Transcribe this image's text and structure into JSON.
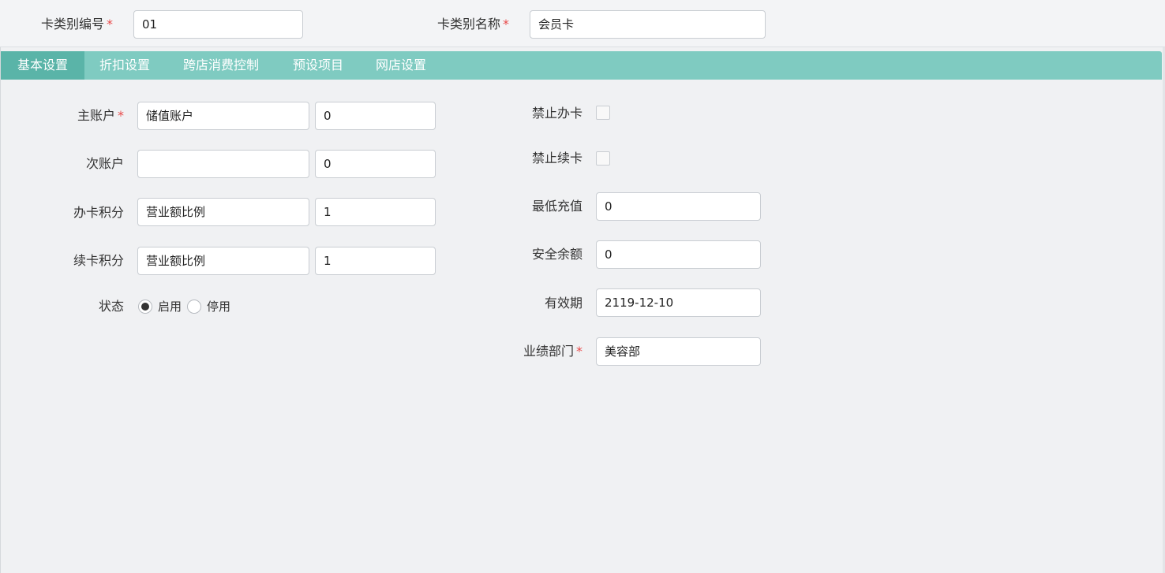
{
  "header": {
    "code_label": "卡类别编号",
    "code_value": "01",
    "name_label": "卡类别名称",
    "name_value": "会员卡",
    "required_mark": "*"
  },
  "tabs": [
    {
      "label": "基本设置",
      "active": true
    },
    {
      "label": "折扣设置",
      "active": false
    },
    {
      "label": "跨店消费控制",
      "active": false
    },
    {
      "label": "预设项目",
      "active": false
    },
    {
      "label": "网店设置",
      "active": false
    }
  ],
  "left": {
    "main_account": {
      "label": "主账户",
      "value": "储值账户",
      "amount": "0"
    },
    "sub_account": {
      "label": "次账户",
      "value": "",
      "amount": "0"
    },
    "open_points": {
      "label": "办卡积分",
      "value": "营业额比例",
      "amount": "1"
    },
    "renew_points": {
      "label": "续卡积分",
      "value": "营业额比例",
      "amount": "1"
    },
    "status": {
      "label": "状态",
      "options": [
        "启用",
        "停用"
      ],
      "selected": "启用"
    }
  },
  "right": {
    "forbid_open": {
      "label": "禁止办卡",
      "checked": false
    },
    "forbid_renew": {
      "label": "禁止续卡",
      "checked": false
    },
    "min_recharge": {
      "label": "最低充值",
      "value": "0"
    },
    "safe_balance": {
      "label": "安全余额",
      "value": "0"
    },
    "expiry": {
      "label": "有效期",
      "value": "2119-12-10"
    },
    "department": {
      "label": "业绩部门",
      "value": "美容部"
    }
  }
}
